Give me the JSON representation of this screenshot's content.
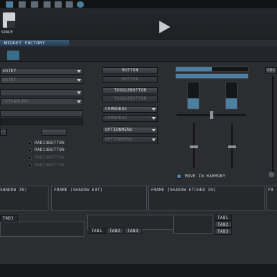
{
  "window": {
    "title": "WIDGET FACTORY",
    "logo_text": "SPACE"
  },
  "top_icons": [
    "app-icon",
    "save-icon",
    "window-icon",
    "document-icon",
    "sound-icon",
    "gear-icon",
    "tools-icon",
    "lock-icon"
  ],
  "colors": {
    "accent": "#3a6d8a",
    "background": "#2b2d31"
  },
  "left": {
    "entry1": "ENTRY",
    "entry2": "ENTRY",
    "combo1": "",
    "combo2": "(DISABLED)",
    "text_entry": "",
    "radios": [
      "RADIOBUTTON",
      "RADIOBUTTON",
      "RADIOBUTTON",
      "RADIOBUTTON"
    ]
  },
  "middle": {
    "button": "BUTTON",
    "button_disabled": "BUTTON",
    "togglebutton": "TOGGLEBUTTON",
    "togglebutton_disabled": "TOGGLEBUTTON",
    "combobox": "COMBOBOX",
    "combobox_disabled": "COMBOBOX",
    "optionmenu": "OPTIONMENU",
    "optionmenu_disabled": "OPTIONMENU"
  },
  "right": {
    "move_in_harmony": "MOVE IN HARMONY",
    "partial_label": "COL"
  },
  "frames": {
    "shadow_in": "SHADOW IN)",
    "shadow_out": "FRAME (SHADOW OUT)",
    "shadow_etched_in": "FRAME (SHADOW ETCHED IN)",
    "partial": "FR"
  },
  "tabs": {
    "left_tab": "TAB3",
    "center_tabs": [
      "TAB1",
      "TAB2",
      "TAB3"
    ],
    "right_tabs": [
      "TAB1",
      "TAB2",
      "TAB3"
    ]
  }
}
